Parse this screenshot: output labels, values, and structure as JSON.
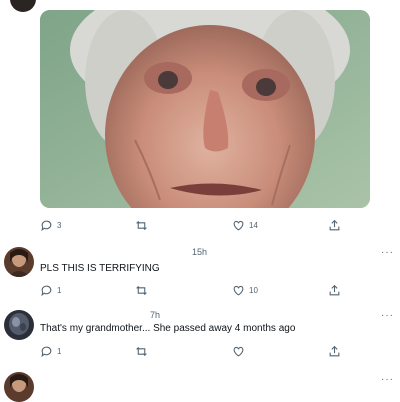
{
  "post": {
    "actions": {
      "replies": "3",
      "retweets": "",
      "likes": "14",
      "share": ""
    }
  },
  "replies": [
    {
      "timestamp": "15h",
      "text": "PLS THIS IS TERRIFYING",
      "actions": {
        "replies": "1",
        "retweets": "",
        "likes": "10"
      }
    },
    {
      "timestamp": "7h",
      "text": "That's my grandmother... She passed away 4 months ago",
      "actions": {
        "replies": "1",
        "retweets": "",
        "likes": ""
      }
    }
  ],
  "more_label": "···",
  "icons": {
    "reply": "reply-bubble-icon",
    "retweet": "retweet-icon",
    "like": "heart-icon",
    "share": "share-icon",
    "more": "more-horizontal-icon"
  },
  "colors": {
    "icon_gray": "#536471",
    "text": "#0f1419",
    "background": "#ffffff"
  }
}
